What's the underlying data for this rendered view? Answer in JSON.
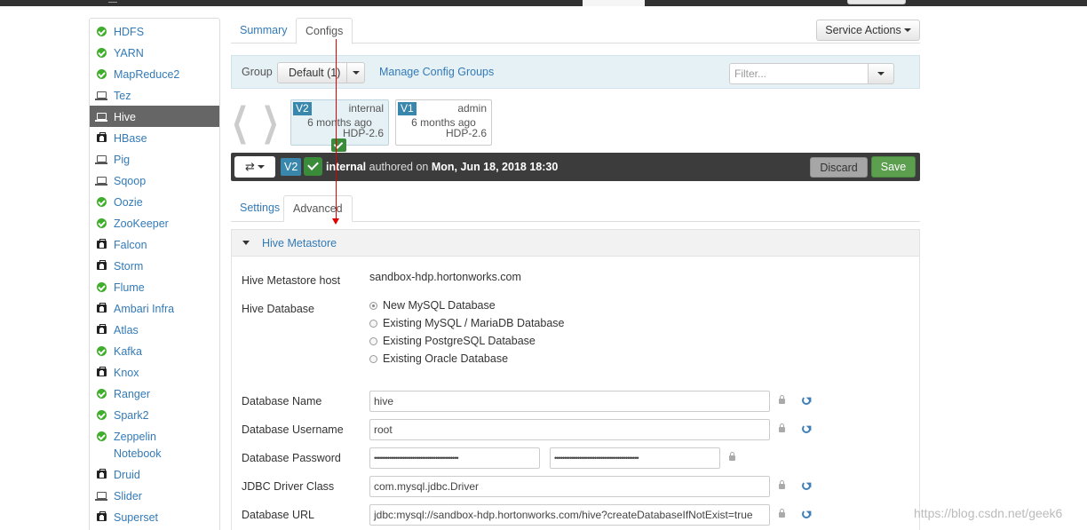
{
  "sidebar": {
    "items": [
      {
        "label": "HDFS",
        "icon": "check-icon"
      },
      {
        "label": "YARN",
        "icon": "check-icon"
      },
      {
        "label": "MapReduce2",
        "icon": "check-icon"
      },
      {
        "label": "Tez",
        "icon": "laptop-icon"
      },
      {
        "label": "Hive",
        "icon": "laptop-icon"
      },
      {
        "label": "HBase",
        "icon": "medkit-icon"
      },
      {
        "label": "Pig",
        "icon": "laptop-icon"
      },
      {
        "label": "Sqoop",
        "icon": "laptop-icon"
      },
      {
        "label": "Oozie",
        "icon": "check-icon"
      },
      {
        "label": "ZooKeeper",
        "icon": "check-icon"
      },
      {
        "label": "Falcon",
        "icon": "medkit-icon"
      },
      {
        "label": "Storm",
        "icon": "medkit-icon"
      },
      {
        "label": "Flume",
        "icon": "check-icon"
      },
      {
        "label": "Ambari Infra",
        "icon": "medkit-icon"
      },
      {
        "label": "Atlas",
        "icon": "medkit-icon"
      },
      {
        "label": "Kafka",
        "icon": "check-icon"
      },
      {
        "label": "Knox",
        "icon": "medkit-icon"
      },
      {
        "label": "Ranger",
        "icon": "check-icon"
      },
      {
        "label": "Spark2",
        "icon": "check-icon"
      },
      {
        "label": "Zeppelin Notebook",
        "icon": "check-icon"
      },
      {
        "label": "Druid",
        "icon": "medkit-icon"
      },
      {
        "label": "Slider",
        "icon": "laptop-icon"
      },
      {
        "label": "Superset",
        "icon": "medkit-icon"
      }
    ],
    "active": "Hive"
  },
  "tabs": {
    "summary": "Summary",
    "configs": "Configs"
  },
  "service_actions": "Service Actions",
  "config_bar": {
    "group_label": "Group",
    "group_value": "Default (1)",
    "manage_link": "Manage Config Groups",
    "filter_placeholder": "Filter..."
  },
  "versions": [
    {
      "badge": "V2",
      "user": "internal",
      "ago": "6 months ago",
      "stack": "HDP-2.6"
    },
    {
      "badge": "V1",
      "user": "admin",
      "ago": "6 months ago",
      "stack": "HDP-2.6"
    }
  ],
  "version_bar": {
    "badge": "V2",
    "author": "internal",
    "authored_on": "authored on",
    "date": "Mon, Jun 18, 2018 18:30",
    "discard": "Discard",
    "save": "Save"
  },
  "subtabs": {
    "settings": "Settings",
    "advanced": "Advanced"
  },
  "section": {
    "title": "Hive Metastore",
    "metastore_host_label": "Hive Metastore host",
    "metastore_host_value": "sandbox-hdp.hortonworks.com",
    "database_label": "Hive Database",
    "database_options": [
      "New MySQL Database",
      "Existing MySQL / MariaDB Database",
      "Existing PostgreSQL Database",
      "Existing Oracle Database"
    ],
    "database_selected": "New MySQL Database",
    "db_name_label": "Database Name",
    "db_name_value": "hive",
    "db_user_label": "Database Username",
    "db_user_value": "root",
    "db_password_label": "Database Password",
    "db_password_value": "••••••••••••••••••••••••••••••••••••••••••••",
    "db_password_confirm": "••••••••••••••••••••••••••••••••••••••••••••",
    "jdbc_class_label": "JDBC Driver Class",
    "jdbc_class_value": "com.mysql.jdbc.Driver",
    "db_url_label": "Database URL",
    "db_url_value": "jdbc:mysql://sandbox-hdp.hortonworks.com/hive?createDatabaseIfNotExist=true"
  },
  "watermark": "https://blog.csdn.net/geek6"
}
